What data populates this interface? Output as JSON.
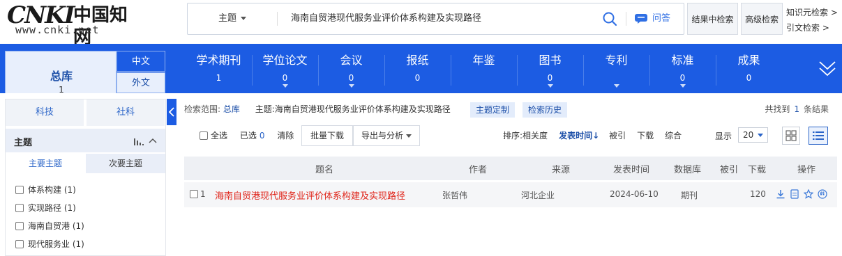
{
  "header": {
    "logo_mark": "CNKI",
    "logo_cn": "中国知网",
    "logo_url": "www.cnki.net",
    "search_field": "主题",
    "search_query": "海南自贸港现代服务业评价体系构建及实现路径",
    "ask_label": "问答",
    "btn_search_within": "结果中检索",
    "btn_advanced": "高级检索",
    "link_knowledge": "知识元检索 >",
    "link_citation": "引文检索 >"
  },
  "nav": {
    "main_db": {
      "name": "总库",
      "count": "1"
    },
    "lang_cn": "中文",
    "lang_en": "外文",
    "items": [
      {
        "name": "学术期刊",
        "count": "1"
      },
      {
        "name": "学位论文",
        "count": "0"
      },
      {
        "name": "会议",
        "count": "0"
      },
      {
        "name": "报纸",
        "count": "0"
      },
      {
        "name": "年鉴",
        "count": ""
      },
      {
        "name": "图书",
        "count": "0"
      },
      {
        "name": "专利",
        "count": ""
      },
      {
        "name": "标准",
        "count": "0"
      },
      {
        "name": "成果",
        "count": "0"
      }
    ]
  },
  "sidebar": {
    "tab_science": "科技",
    "tab_social": "社科",
    "facet_title": "主题",
    "subtab_primary": "主要主题",
    "subtab_secondary": "次要主题",
    "items": [
      {
        "label": "体系构建",
        "count": "(1)"
      },
      {
        "label": "实现路径",
        "count": "(1)"
      },
      {
        "label": "海南自贸港",
        "count": "(1)"
      },
      {
        "label": "现代服务业",
        "count": "(1)"
      }
    ]
  },
  "results": {
    "scope_label": "检索范围:",
    "scope_lib": "总库",
    "scope_query": "主题:海南自贸港现代服务业评价体系构建及实现路径",
    "chip_custom": "主题定制",
    "chip_history": "检索历史",
    "found_prefix": "共找到",
    "found_count": "1",
    "found_suffix": "条结果",
    "select_all": "全选",
    "selected_label": "已选",
    "selected_count": "0",
    "clear": "清除",
    "btn_batch_download": "批量下载",
    "btn_export": "导出与分析",
    "sort_label": "排序:",
    "sort_relevance": "相关度",
    "sort_date": "发表时间↓",
    "sort_cited": "被引",
    "sort_download": "下载",
    "sort_comprehensive": "综合",
    "display_label": "显示",
    "per_page": "20",
    "columns": {
      "title": "题名",
      "author": "作者",
      "source": "来源",
      "date": "发表时间",
      "database": "数据库",
      "cited": "被引",
      "downloads": "下载",
      "ops": "操作"
    },
    "rows": [
      {
        "index": "1",
        "title": "海南自贸港现代服务业评价体系构建及实现路径",
        "author": "张哲伟",
        "source": "河北企业",
        "date": "2024-06-10",
        "database": "期刊",
        "cited": "",
        "downloads": "120"
      }
    ]
  },
  "colors": {
    "brand_blue": "#1c5ce3",
    "title_red": "#e0261b",
    "link_blue": "#1c4fa8"
  }
}
